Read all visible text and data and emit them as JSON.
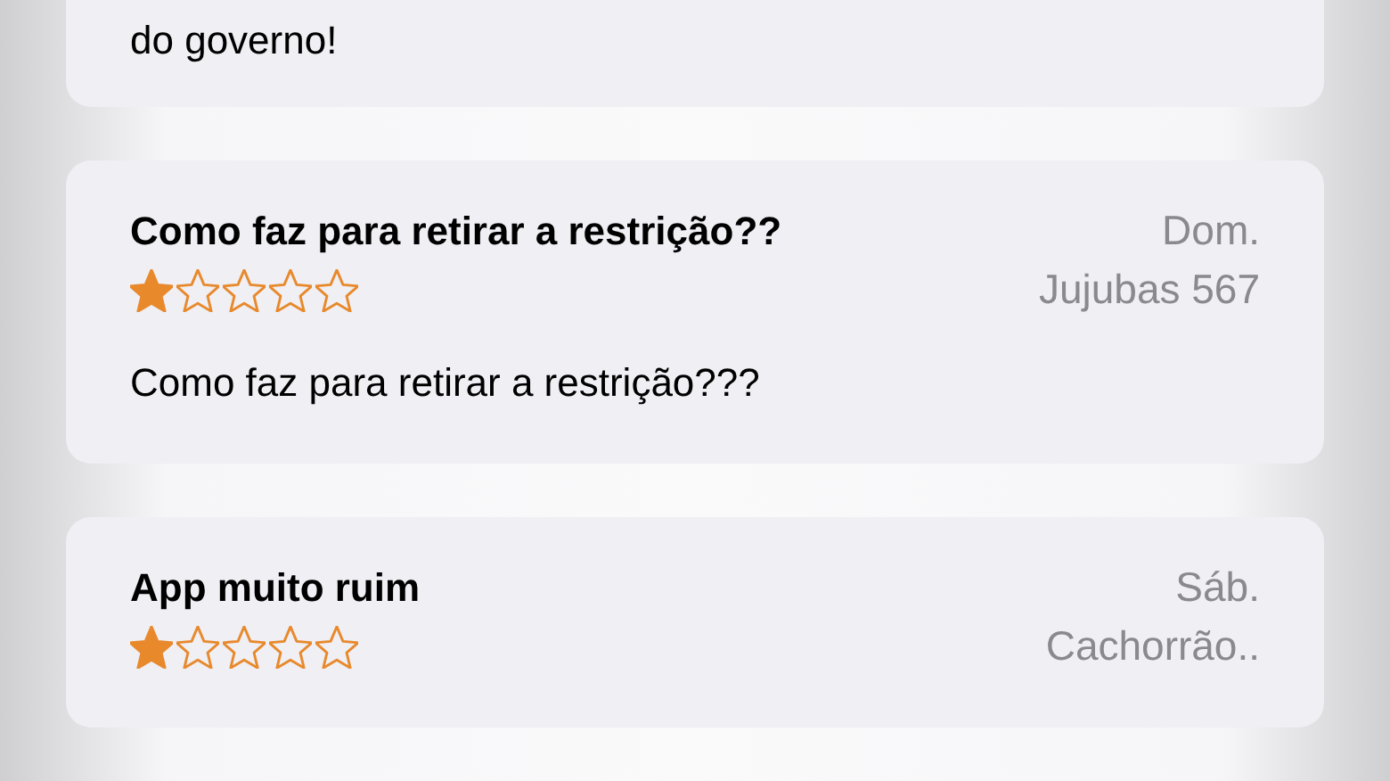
{
  "reviews": [
    {
      "body": "do governo!"
    },
    {
      "title": "Como faz para retirar a restrição??",
      "date": "Dom.",
      "stars": 1,
      "author": "Jujubas 567",
      "body": "Como faz para retirar a restrição???"
    },
    {
      "title": "App muito ruim",
      "date": "Sáb.",
      "stars": 1,
      "author": "Cachorrão.."
    }
  ]
}
